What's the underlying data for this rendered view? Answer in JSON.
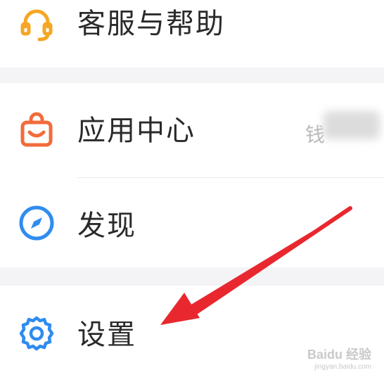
{
  "menu": {
    "items": [
      {
        "label": "客服与帮助",
        "icon": "headset-icon",
        "color": "#F5A623"
      },
      {
        "label": "应用中心",
        "icon": "shopping-bag-icon",
        "color": "#F26B3A",
        "hint": "钱"
      },
      {
        "label": "发现",
        "icon": "compass-icon",
        "color": "#2F8CF0"
      },
      {
        "label": "设置",
        "icon": "gear-icon",
        "color": "#2F8CF0"
      }
    ]
  },
  "annotation": {
    "arrow_color": "#E8282E",
    "points_to": "设置"
  },
  "watermark": {
    "brand": "Baidu 经验",
    "url": "jingyan.baidu.com"
  }
}
